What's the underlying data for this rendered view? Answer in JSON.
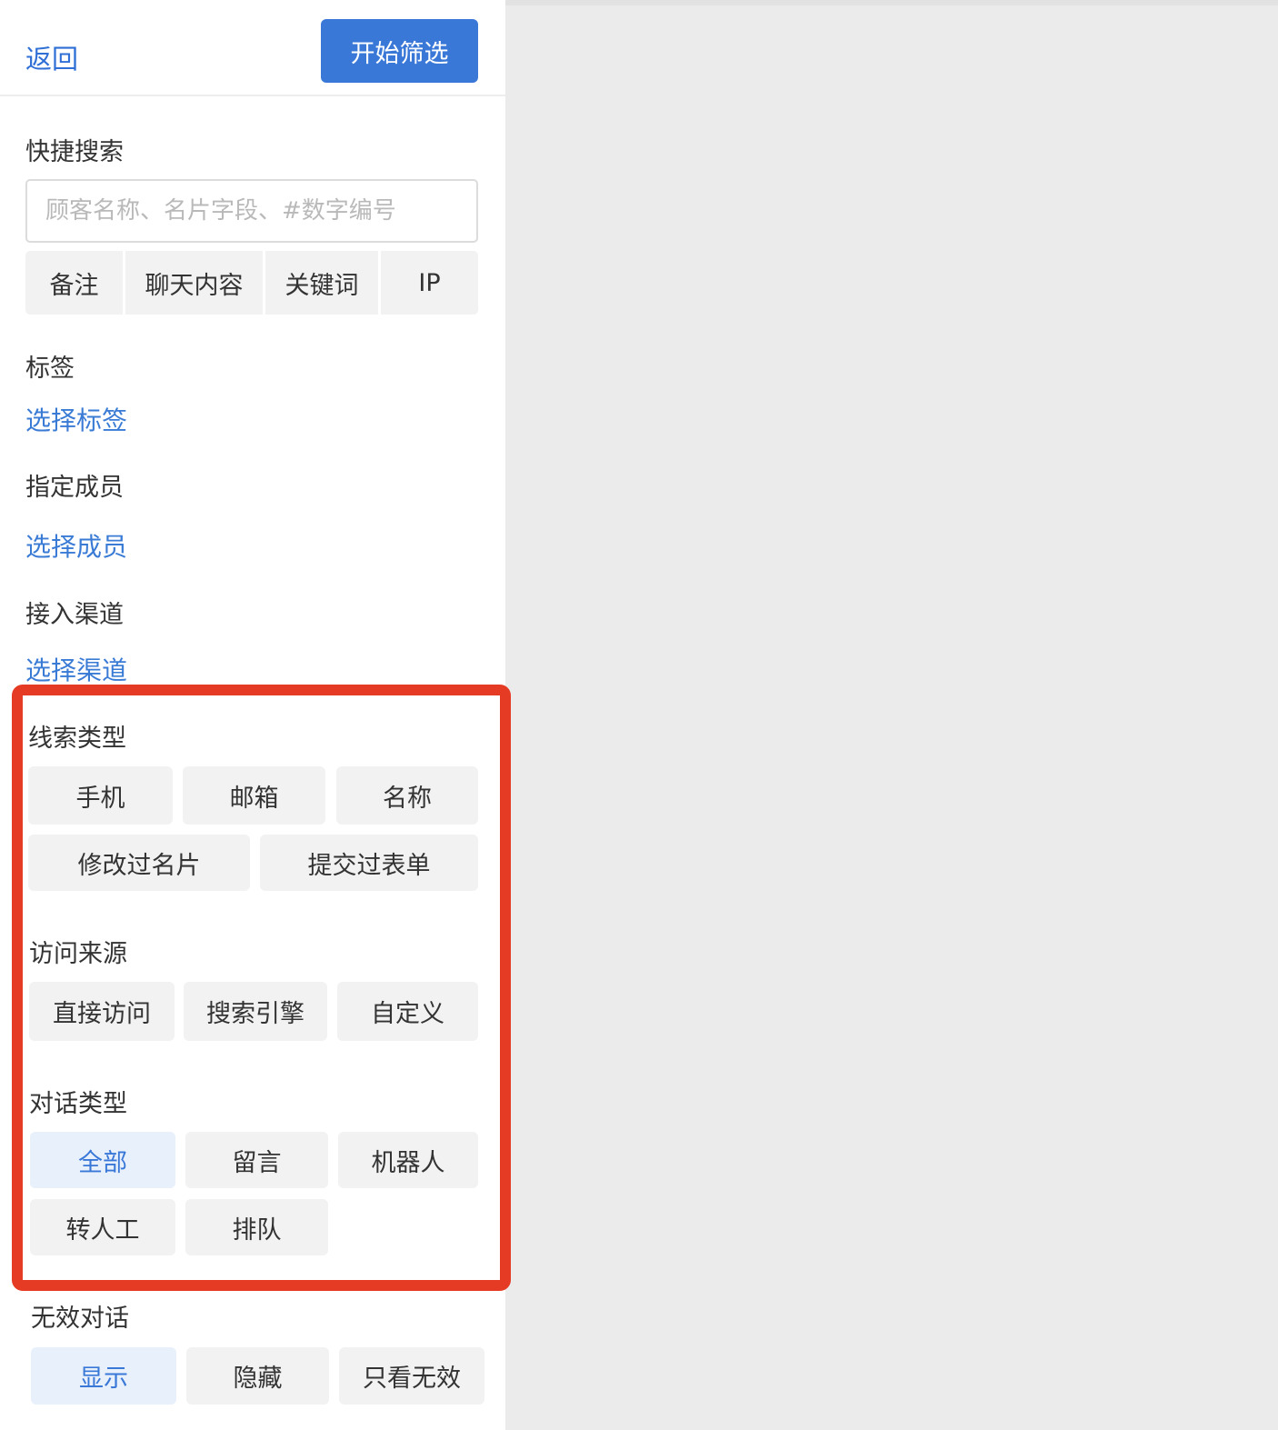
{
  "header": {
    "back_label": "返回",
    "start_label": "开始筛选"
  },
  "quick_search": {
    "label": "快捷搜索",
    "placeholder": "顾客名称、名片字段、#数字编号",
    "value": "",
    "options": [
      "备注",
      "聊天内容",
      "关键词",
      "IP"
    ]
  },
  "tags": {
    "label": "标签",
    "action": "选择标签"
  },
  "members": {
    "label": "指定成员",
    "action": "选择成员"
  },
  "channels": {
    "label": "接入渠道",
    "action": "选择渠道"
  },
  "lead_type": {
    "label": "线索类型",
    "options": [
      "手机",
      "邮箱",
      "名称",
      "修改过名片",
      "提交过表单"
    ]
  },
  "visit_source": {
    "label": "访问来源",
    "options": [
      "直接访问",
      "搜索引擎",
      "自定义"
    ]
  },
  "dialog_type": {
    "label": "对话类型",
    "options": [
      "全部",
      "留言",
      "机器人",
      "转人工",
      "排队"
    ],
    "selected": "全部"
  },
  "invalid_dialog": {
    "label": "无效对话",
    "options": [
      "显示",
      "隐藏",
      "只看无效"
    ],
    "selected": "显示"
  },
  "colors": {
    "accent": "#3a78d8",
    "link": "#3a7bd5",
    "highlight": "#e53b24",
    "chip_background": "#f2f2f2",
    "chip_selected_background": "#e8f0fb",
    "canvas_background": "#ebebeb"
  }
}
